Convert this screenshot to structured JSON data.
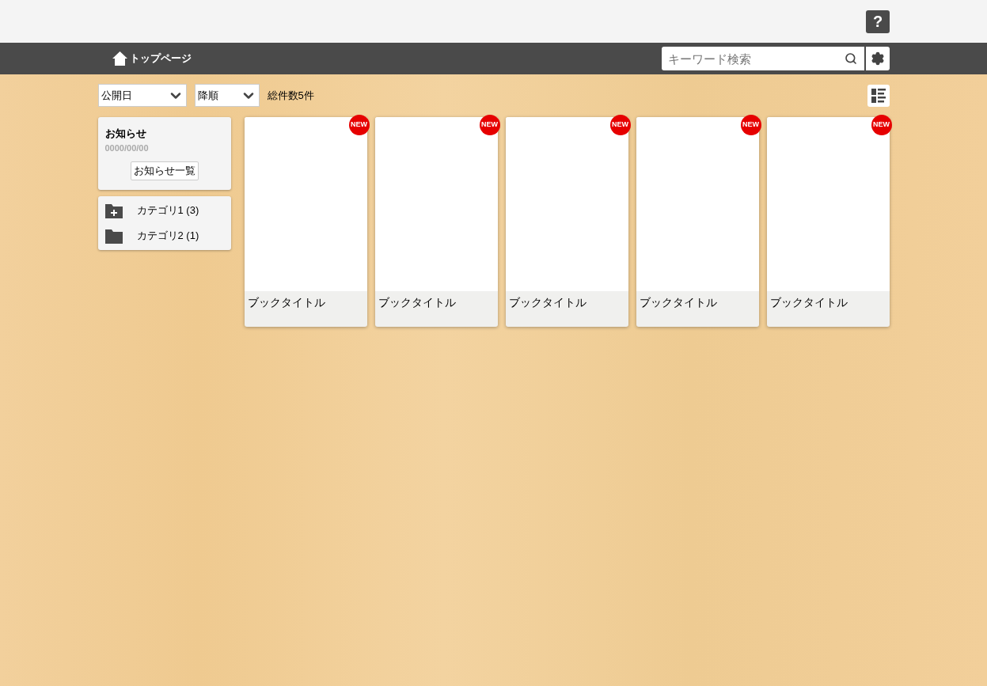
{
  "help_button": {
    "label": "?"
  },
  "nav": {
    "home_label": "トップページ",
    "search": {
      "placeholder": "キーワード検索"
    }
  },
  "toolbar": {
    "sort_field": "公開日",
    "sort_order": "降順",
    "total": "総件数5件"
  },
  "notice": {
    "title": "お知らせ",
    "date": "0000/00/00",
    "button": "お知らせ一覧"
  },
  "categories": [
    {
      "label": "カテゴリ1 (3)",
      "kind": "parent"
    },
    {
      "label": "カテゴリ2 (1)",
      "kind": "leaf"
    }
  ],
  "books": [
    {
      "title": "ブックタイトル",
      "badge": "NEW"
    },
    {
      "title": "ブックタイトル",
      "badge": "NEW"
    },
    {
      "title": "ブックタイトル",
      "badge": "NEW"
    },
    {
      "title": "ブックタイトル",
      "badge": "NEW"
    },
    {
      "title": "ブックタイトル",
      "badge": "NEW"
    }
  ]
}
